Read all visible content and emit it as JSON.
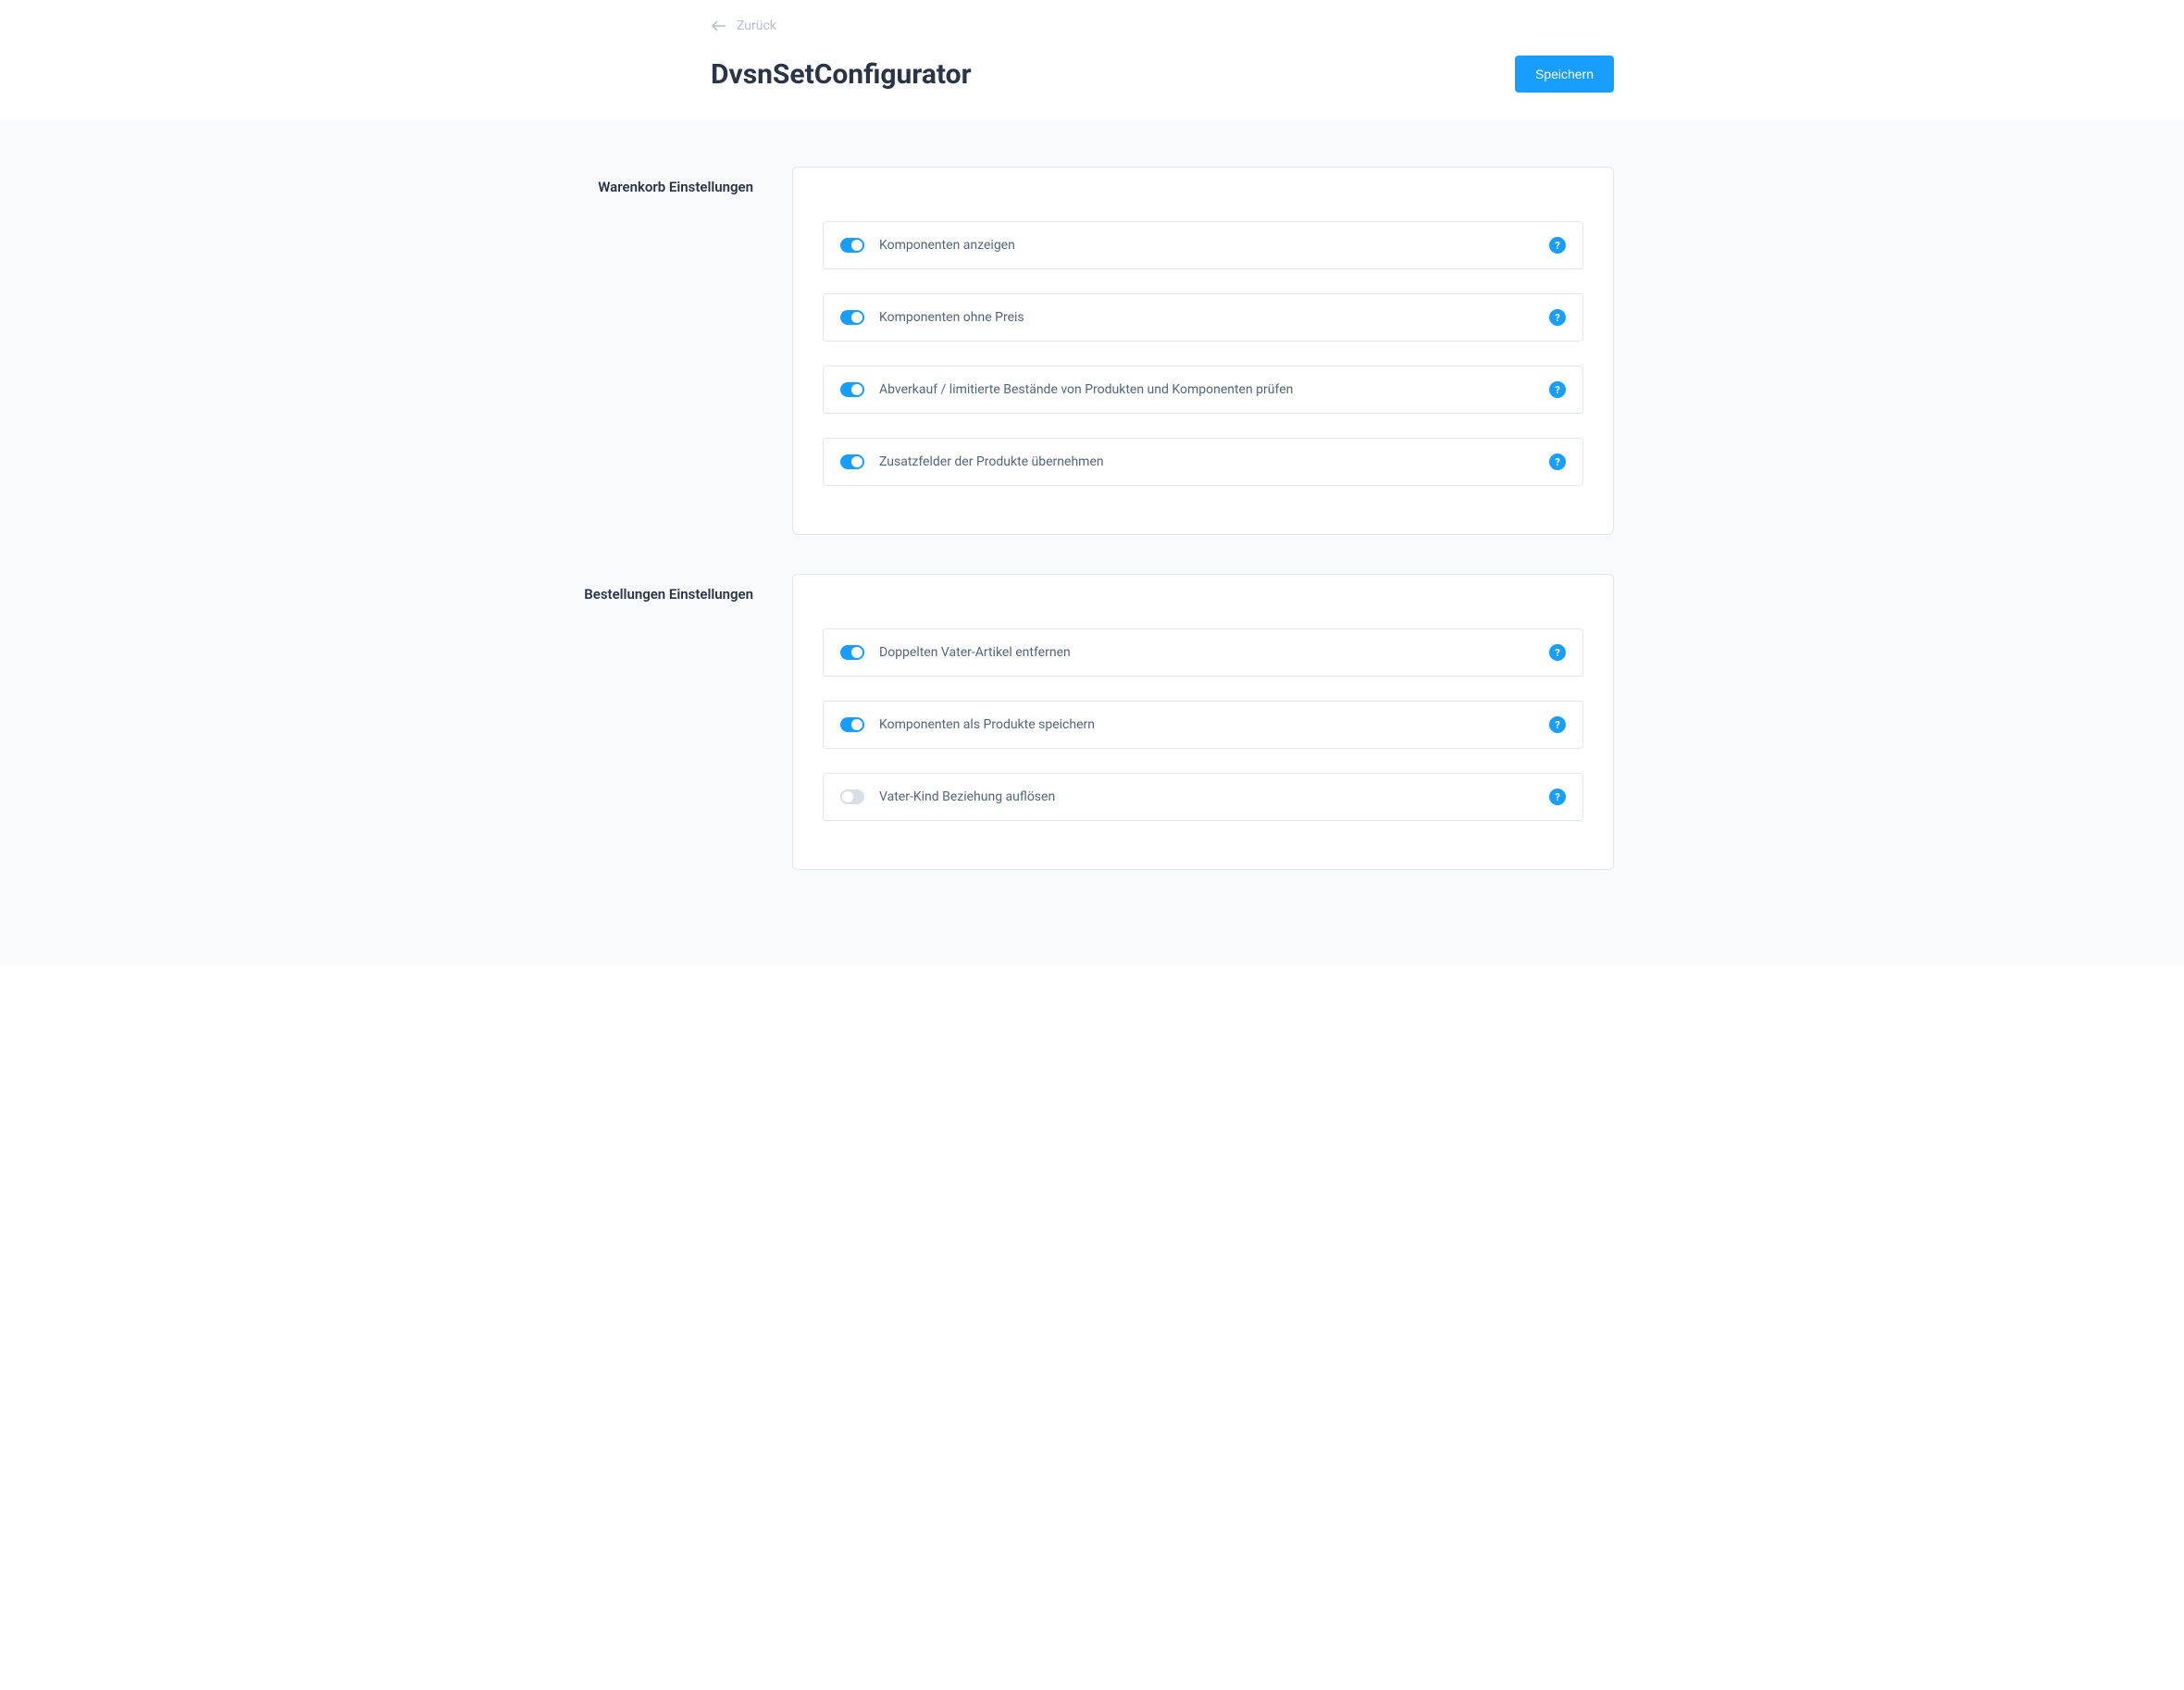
{
  "header": {
    "back_label": "Zurück",
    "title": "DvsnSetConfigurator",
    "save_label": "Speichern"
  },
  "sections": {
    "cart": {
      "label": "Warenkorb Einstellungen",
      "items": [
        {
          "label": "Komponenten anzeigen",
          "enabled": true
        },
        {
          "label": "Komponenten ohne Preis",
          "enabled": true
        },
        {
          "label": "Abverkauf / limitierte Bestände von Produkten und Komponenten prüfen",
          "enabled": true
        },
        {
          "label": "Zusatzfelder der Produkte übernehmen",
          "enabled": true
        }
      ]
    },
    "orders": {
      "label": "Bestellungen Einstellungen",
      "items": [
        {
          "label": "Doppelten Vater-Artikel entfernen",
          "enabled": true
        },
        {
          "label": "Komponenten als Produkte speichern",
          "enabled": true
        },
        {
          "label": "Vater-Kind Beziehung auflösen",
          "enabled": false
        }
      ]
    }
  }
}
